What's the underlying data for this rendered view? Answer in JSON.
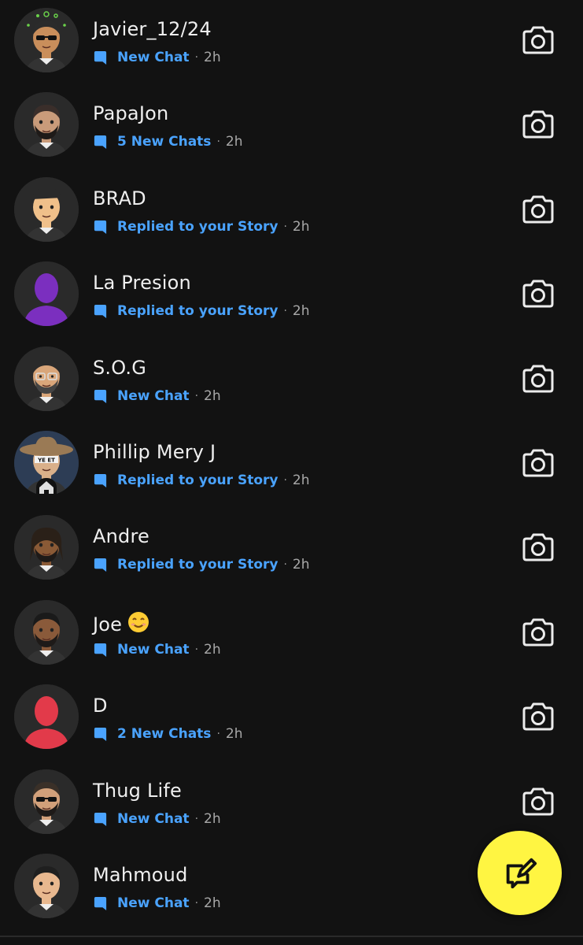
{
  "chats": [
    {
      "name": "Javier_12/24",
      "status": "New Chat",
      "time": "2h",
      "avatar": {
        "skin": "#c98e5b",
        "hair": "#2b2b2b",
        "bg": "#2a2a2a",
        "accessory": "sunglasses-and-sparkles"
      }
    },
    {
      "name": "PapaJon",
      "status": "5 New Chats",
      "time": "2h",
      "avatar": {
        "skin": "#c99b7a",
        "hair": "#3a2e2a",
        "bg": "#2a2a2a",
        "accessory": "beard"
      }
    },
    {
      "name": "BRAD",
      "status": "Replied to your Story",
      "time": "2h",
      "avatar": {
        "skin": "#f0c08a",
        "hair": "#3a3a3a",
        "bg": "#2a2a2a",
        "accessory": "cap"
      }
    },
    {
      "name": "La Presion",
      "status": "Replied to your Story",
      "time": "2h",
      "avatar": {
        "skin": "#7b2fbf",
        "hair": "#7b2fbf",
        "bg": "#2a2a2a",
        "accessory": "silhouette"
      }
    },
    {
      "name": "S.O.G",
      "status": "New Chat",
      "time": "2h",
      "avatar": {
        "skin": "#d9a67a",
        "hair": "#2a2a2a",
        "bg": "#2a2a2a",
        "accessory": "glasses"
      }
    },
    {
      "name": "Phillip Mery J",
      "status": "Replied to your Story",
      "time": "2h",
      "avatar": {
        "skin": "#d9b08a",
        "hair": "#9a7a55",
        "bg": "#2d3d55",
        "accessory": "cowboy-hat"
      }
    },
    {
      "name": "Andre",
      "status": "Replied to your Story",
      "time": "2h",
      "avatar": {
        "skin": "#8a5a36",
        "hair": "#2a2018",
        "bg": "#2a2a2a",
        "accessory": "dreads"
      }
    },
    {
      "name": "Joe",
      "status": "New Chat",
      "time": "2h",
      "avatar": {
        "skin": "#8a5a3a",
        "hair": "#1a1a1a",
        "bg": "#2a2a2a",
        "accessory": "beard"
      }
    },
    {
      "name": "D",
      "status": "2 New Chats",
      "time": "2h",
      "avatar": {
        "skin": "#e23a4a",
        "hair": "#e23a4a",
        "bg": "#2a2a2a",
        "accessory": "silhouette"
      }
    },
    {
      "name": "Thug Life",
      "status": "New Chat",
      "time": "2h",
      "avatar": {
        "skin": "#d2a07a",
        "hair": "#3a3028",
        "bg": "#2a2a2a",
        "accessory": "sunglasses"
      }
    },
    {
      "name": "Mahmoud",
      "status": "New Chat",
      "time": "2h",
      "avatar": {
        "skin": "#e8b88f",
        "hair": "#1f1f1f",
        "bg": "#2a2a2a",
        "accessory": "none"
      }
    }
  ],
  "joe_emoji": "smiling-face-emoji",
  "phillip_badge": "home-icon",
  "row_icon": "camera-icon",
  "status_icon": "chat-bubble-icon",
  "fab_icon": "new-chat-icon",
  "colors": {
    "background": "#121212",
    "status_blue": "#4aa3ff",
    "fab_yellow": "#fff542"
  }
}
